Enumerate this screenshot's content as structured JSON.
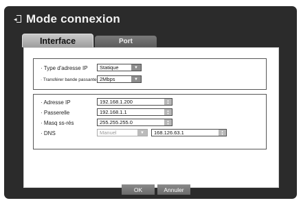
{
  "dialog": {
    "title": "Mode connexion",
    "title_icon": "exit-icon"
  },
  "tabs": [
    {
      "label": "Interface",
      "active": true
    },
    {
      "label": "Port",
      "active": false
    }
  ],
  "group1": {
    "ip_type_label": "· Type d'adresse IP",
    "ip_type_value": "Statique",
    "bandwidth_label": "· Transférer bande passante",
    "bandwidth_value": "2Mbps"
  },
  "group2": {
    "ip_label": "· Adresse IP",
    "ip_value": "192.168.1.200",
    "gateway_label": "· Passerelle",
    "gateway_value": "192.168.1.1",
    "mask_label": "· Masq ss-rés",
    "mask_value": "255.255.255.0",
    "dns_label": "· DNS",
    "dns_mode_value": "Manuel",
    "dns_value": "168.126.63.1"
  },
  "buttons": {
    "ok": "OK",
    "cancel": "Annuler"
  },
  "colors": {
    "dialog_bg": "#2b2b2b",
    "panel_bg": "#ffffff",
    "button_bg": "#7a7a7a"
  }
}
